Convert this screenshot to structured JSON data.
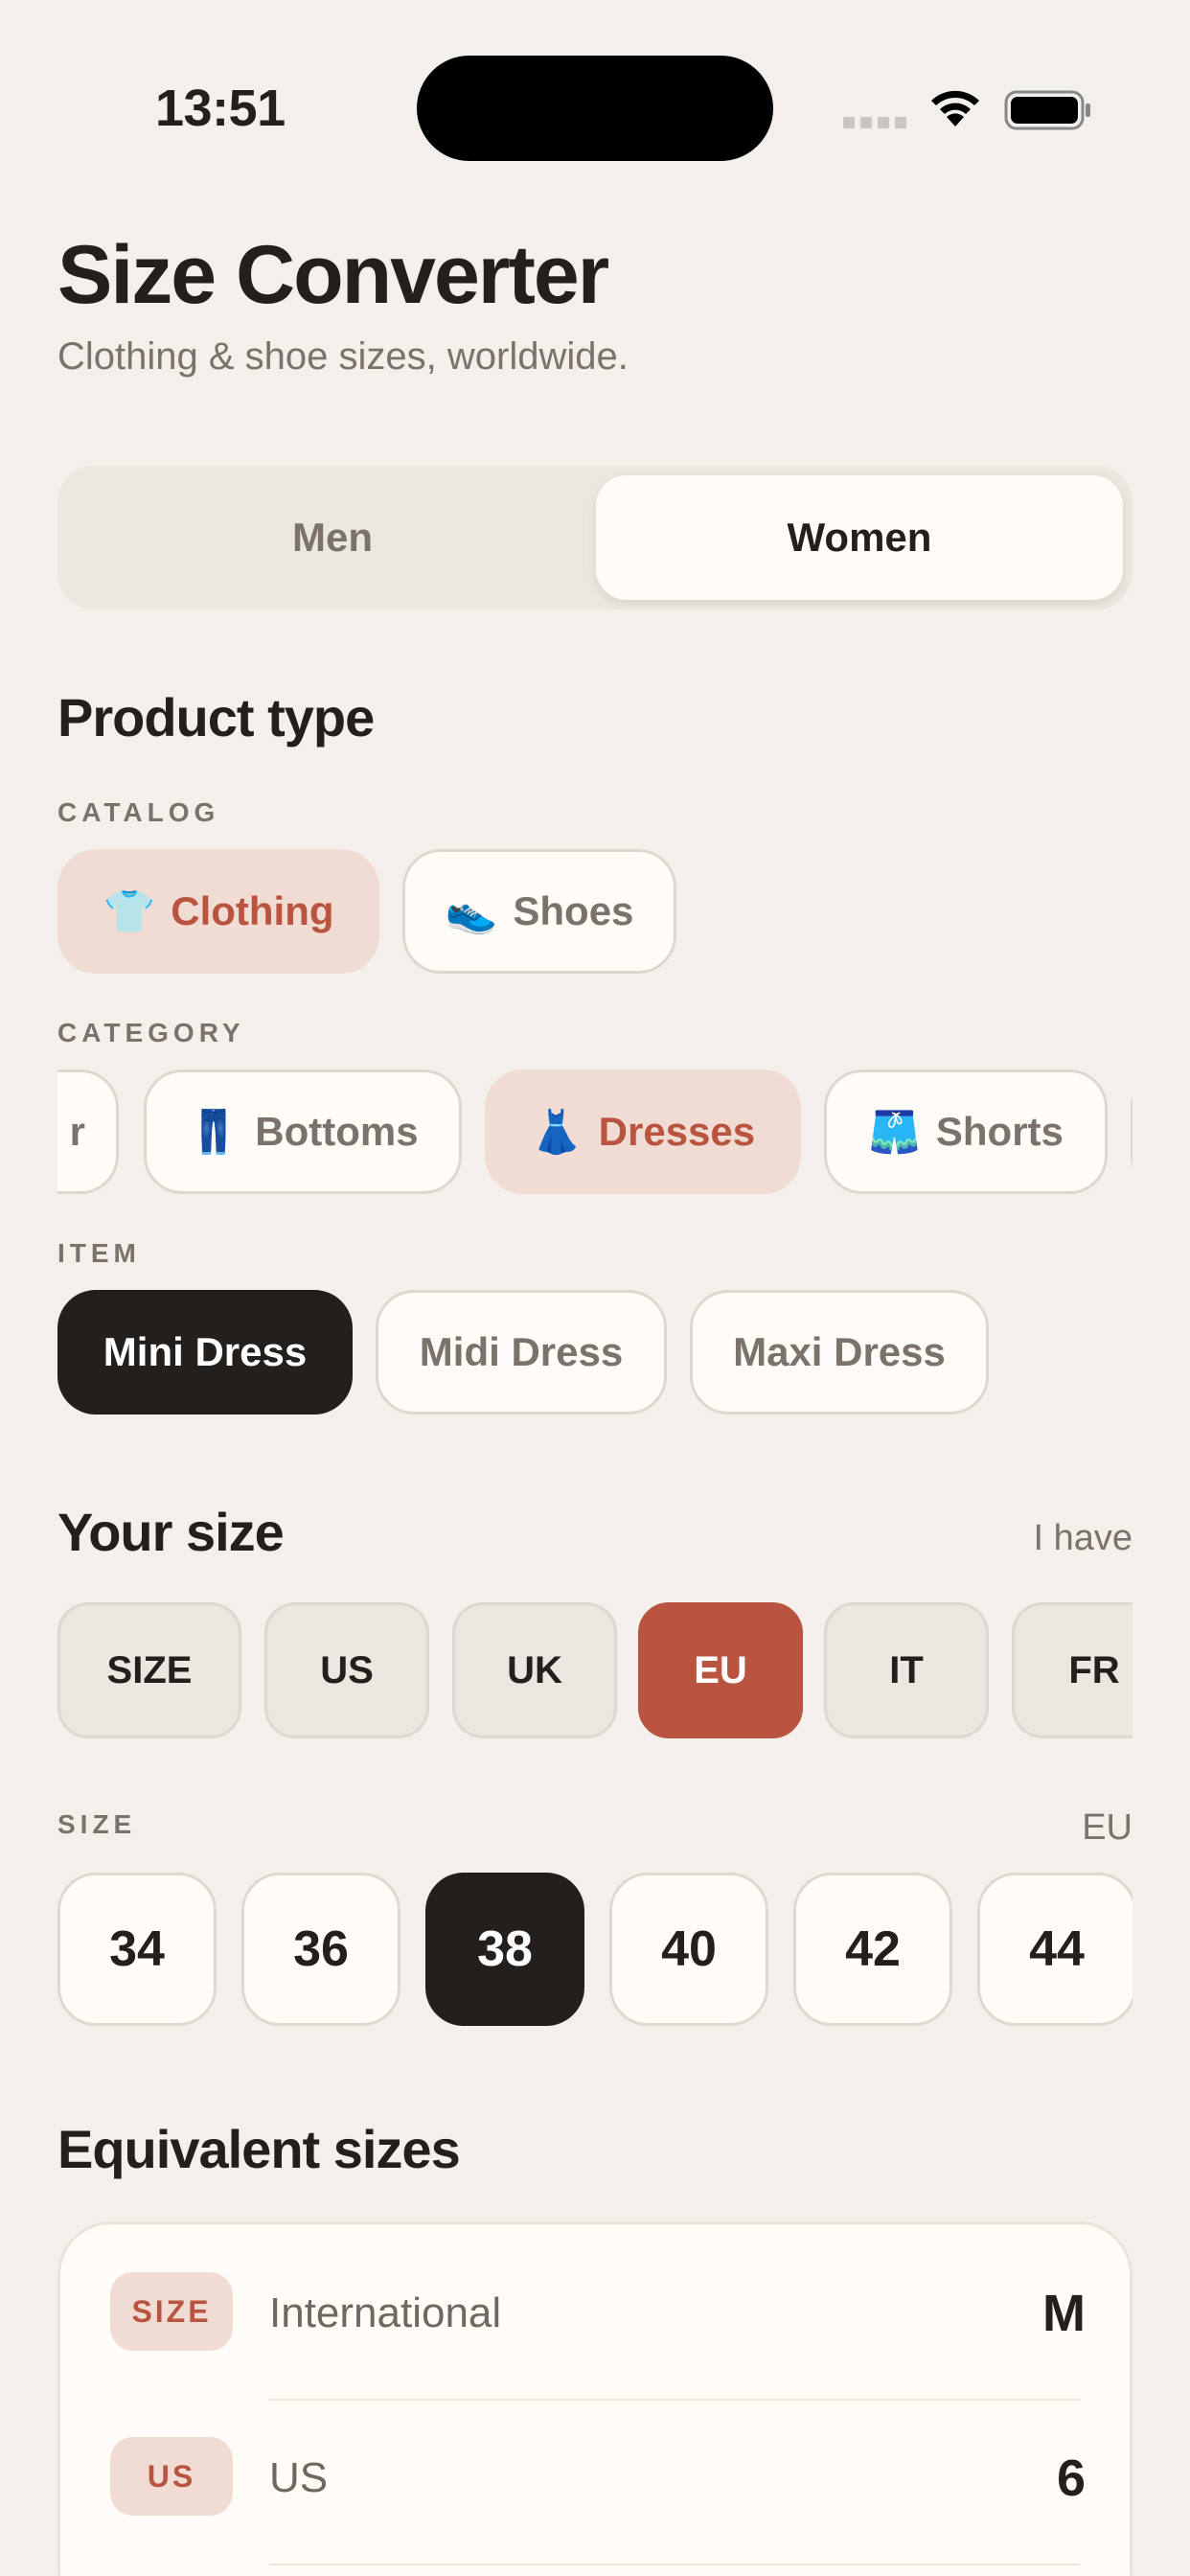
{
  "status": {
    "time": "13:51"
  },
  "header": {
    "title": "Size Converter",
    "subtitle": "Clothing & shoe sizes, worldwide."
  },
  "gender": {
    "options": [
      "Men",
      "Women"
    ],
    "selected": "Women"
  },
  "product_type": {
    "heading": "Product type",
    "catalog_label": "CATALOG",
    "catalog": [
      {
        "icon": "👕",
        "icon_name": "tshirt-icon",
        "label": "Clothing",
        "selected": true
      },
      {
        "icon": "👟",
        "icon_name": "sneaker-icon",
        "label": "Shoes",
        "selected": false
      }
    ],
    "category_label": "CATEGORY",
    "category": [
      {
        "label": "r",
        "partial": true
      },
      {
        "icon": "👖",
        "icon_name": "jeans-icon",
        "label": "Bottoms",
        "selected": false
      },
      {
        "icon": "👗",
        "icon_name": "dress-icon",
        "label": "Dresses",
        "selected": true
      },
      {
        "icon": "🩳",
        "icon_name": "shorts-icon",
        "label": "Shorts",
        "selected": false
      }
    ],
    "item_label": "ITEM",
    "items": [
      {
        "label": "Mini Dress",
        "selected": true
      },
      {
        "label": "Midi Dress",
        "selected": false
      },
      {
        "label": "Maxi Dress",
        "selected": false
      }
    ]
  },
  "your_size": {
    "heading": "Your size",
    "hint": "I have",
    "systems": [
      "SIZE",
      "US",
      "UK",
      "EU",
      "IT",
      "FR"
    ],
    "selected_system": "EU",
    "size_label": "SIZE",
    "size_unit": "EU",
    "sizes": [
      "34",
      "36",
      "38",
      "40",
      "42",
      "44"
    ],
    "selected_size": "38"
  },
  "equivalent": {
    "heading": "Equivalent sizes",
    "rows": [
      {
        "badge": "SIZE",
        "name": "International",
        "value": "M"
      },
      {
        "badge": "US",
        "name": "US",
        "value": "6"
      }
    ]
  },
  "colors": {
    "accent": "#B8543F",
    "accent_soft": "#F1DCD4",
    "dark": "#231F1C",
    "background": "#F3F0EB"
  }
}
